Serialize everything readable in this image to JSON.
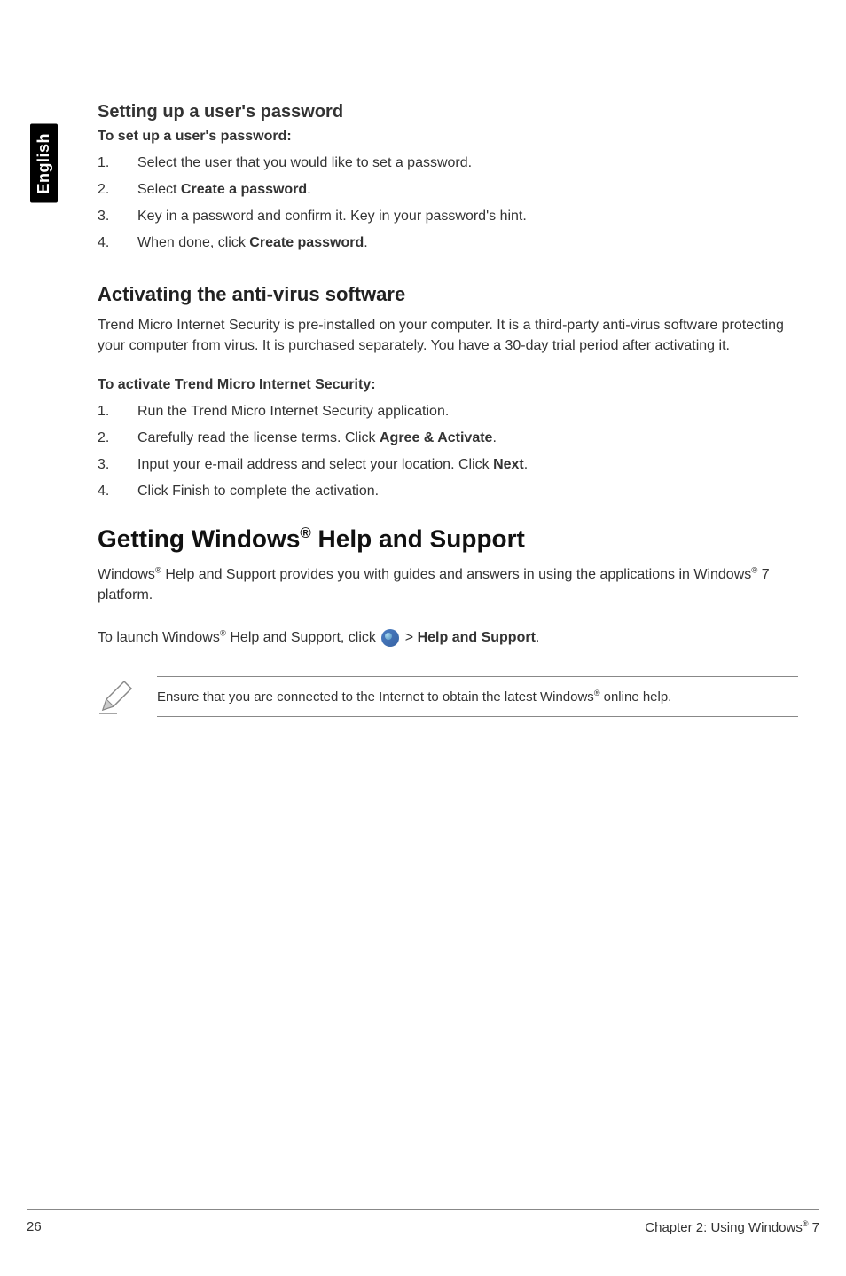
{
  "sideTab": "English",
  "section1": {
    "title": "Setting up a user's password",
    "subtitle": "To set up a user's password:",
    "items": [
      {
        "num": "1.",
        "parts": [
          {
            "t": "Select the user that you would like to set a password."
          }
        ]
      },
      {
        "num": "2.",
        "parts": [
          {
            "t": "Select "
          },
          {
            "t": "Create a password",
            "b": true
          },
          {
            "t": "."
          }
        ]
      },
      {
        "num": "3.",
        "parts": [
          {
            "t": "Key in a password and confirm it. Key in your password's hint."
          }
        ]
      },
      {
        "num": "4.",
        "parts": [
          {
            "t": "When done, click "
          },
          {
            "t": "Create password",
            "b": true
          },
          {
            "t": "."
          }
        ]
      }
    ]
  },
  "section2": {
    "title": "Activating the anti-virus software",
    "para": "Trend Micro Internet Security is pre-installed on your computer. It is a third-party anti-virus software protecting your computer from virus. It is purchased separately. You have a 30-day trial period after activating it.",
    "subtitle": "To activate Trend Micro Internet Security:",
    "items": [
      {
        "num": "1.",
        "parts": [
          {
            "t": "Run the Trend Micro Internet Security application."
          }
        ]
      },
      {
        "num": "2.",
        "parts": [
          {
            "t": "Carefully read the license terms. Click "
          },
          {
            "t": "Agree & Activate",
            "b": true
          },
          {
            "t": "."
          }
        ]
      },
      {
        "num": "3.",
        "parts": [
          {
            "t": "Input your e-mail address and select your location. Click "
          },
          {
            "t": "Next",
            "b": true
          },
          {
            "t": "."
          }
        ]
      },
      {
        "num": "4.",
        "parts": [
          {
            "t": "Click Finish to complete the activation."
          }
        ]
      }
    ]
  },
  "section3": {
    "titlePre": "Getting Windows",
    "titleSup": "®",
    "titlePost": " Help and Support",
    "para1Pre": "Windows",
    "para1Sup": "®",
    "para1Mid": " Help and Support provides you with guides and answers in using the applications in Windows",
    "para1Sup2": "®",
    "para1Post": " 7 platform.",
    "para2Pre": "To launch Windows",
    "para2Sup": "®",
    "para2Mid": " Help and Support, click ",
    "para2IconName": "start-icon",
    "para2Gt": " > ",
    "para2Bold": "Help and Support",
    "para2Post": "."
  },
  "note": {
    "textPre": "Ensure that you are connected to the Internet to obtain the latest Windows",
    "textSup": "®",
    "textPost": " online help."
  },
  "footer": {
    "page": "26",
    "chapterPre": "Chapter 2: Using Windows",
    "chapterSup": "®",
    "chapterPost": " 7"
  }
}
